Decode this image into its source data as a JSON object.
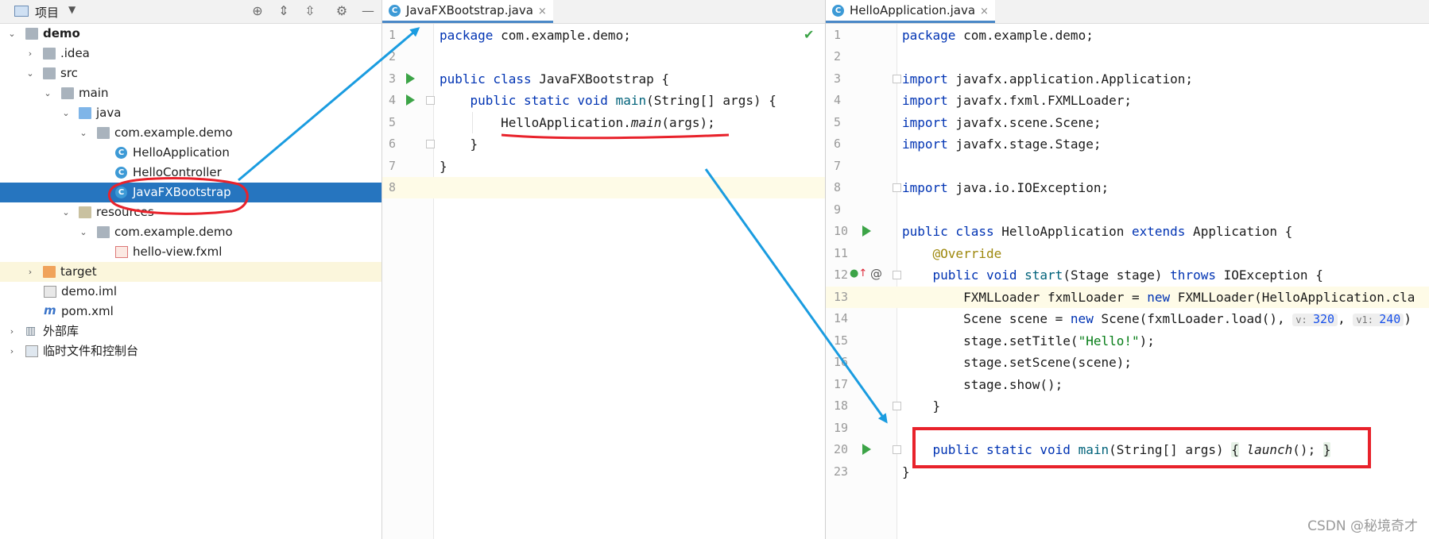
{
  "project_panel": {
    "title": "项目",
    "header_icons": [
      "locate-icon",
      "expand-all-icon",
      "collapse-all-icon",
      "gear-icon",
      "minimize-icon"
    ],
    "tree": [
      {
        "label": "demo",
        "icon": "folder-icon",
        "expanded": true,
        "bold": true
      },
      {
        "label": ".idea",
        "icon": "folder-icon",
        "expanded": false
      },
      {
        "label": "src",
        "icon": "folder-icon",
        "expanded": true
      },
      {
        "label": "main",
        "icon": "folder-icon",
        "expanded": true
      },
      {
        "label": "java",
        "icon": "source-folder-icon",
        "expanded": true
      },
      {
        "label": "com.example.demo",
        "icon": "package-icon",
        "expanded": true
      },
      {
        "label": "HelloApplication",
        "icon": "class-icon"
      },
      {
        "label": "HelloController",
        "icon": "class-icon"
      },
      {
        "label": "JavaFXBootstrap",
        "icon": "class-icon",
        "selected": true
      },
      {
        "label": "resources",
        "icon": "resources-folder-icon",
        "expanded": true
      },
      {
        "label": "com.example.demo",
        "icon": "package-icon",
        "expanded": true
      },
      {
        "label": "hello-view.fxml",
        "icon": "fxml-file-icon"
      },
      {
        "label": "target",
        "icon": "excluded-folder-icon",
        "expanded": false
      },
      {
        "label": "demo.iml",
        "icon": "iml-file-icon"
      },
      {
        "label": "pom.xml",
        "icon": "maven-icon"
      },
      {
        "label": "外部库",
        "icon": "library-icon",
        "expanded": false
      },
      {
        "label": "临时文件和控制台",
        "icon": "scratch-icon",
        "expanded": false
      }
    ]
  },
  "editor_left": {
    "tab": {
      "label": "JavaFXBootstrap.java",
      "close": "×"
    },
    "lines": [
      {
        "n": "1",
        "text": "package com.example.demo;"
      },
      {
        "n": "2",
        "text": ""
      },
      {
        "n": "3",
        "text": "public class JavaFXBootstrap {"
      },
      {
        "n": "4",
        "text": "    public static void main(String[] args) {"
      },
      {
        "n": "5",
        "text": "        HelloApplication.main(args);"
      },
      {
        "n": "6",
        "text": "    }"
      },
      {
        "n": "7",
        "text": "}"
      },
      {
        "n": "8",
        "text": ""
      }
    ]
  },
  "editor_right": {
    "tab": {
      "label": "HelloApplication.java",
      "close": "×"
    },
    "lines": [
      {
        "n": "1",
        "text": "package com.example.demo;"
      },
      {
        "n": "2",
        "text": ""
      },
      {
        "n": "3",
        "text": "import javafx.application.Application;"
      },
      {
        "n": "4",
        "text": "import javafx.fxml.FXMLLoader;"
      },
      {
        "n": "5",
        "text": "import javafx.scene.Scene;"
      },
      {
        "n": "6",
        "text": "import javafx.stage.Stage;"
      },
      {
        "n": "7",
        "text": ""
      },
      {
        "n": "8",
        "text": "import java.io.IOException;"
      },
      {
        "n": "9",
        "text": ""
      },
      {
        "n": "10",
        "text": "public class HelloApplication extends Application {"
      },
      {
        "n": "11",
        "text": "    @Override"
      },
      {
        "n": "12",
        "text": "    public void start(Stage stage) throws IOException {"
      },
      {
        "n": "13",
        "text": "        FXMLLoader fxmlLoader = new FXMLLoader(HelloApplication.cla"
      },
      {
        "n": "14",
        "text": "        Scene scene = new Scene(fxmlLoader.load(), v: 320, v1: 240)"
      },
      {
        "n": "15",
        "text": "        stage.setTitle(\"Hello!\");"
      },
      {
        "n": "16",
        "text": "        stage.setScene(scene);"
      },
      {
        "n": "17",
        "text": "        stage.show();"
      },
      {
        "n": "18",
        "text": "    }"
      },
      {
        "n": "19",
        "text": ""
      },
      {
        "n": "20",
        "text": "    public static void main(String[] args) { launch(); }"
      },
      {
        "n": "23",
        "text": "}"
      }
    ],
    "hints": {
      "v_label": "v:",
      "v_value": "320",
      "v1_label": "v1:",
      "v1_value": "240"
    }
  },
  "watermark": "CSDN @秘境奇才",
  "annotation_colors": {
    "arrow": "#1a9ce0",
    "highlight": "#e8222b"
  }
}
